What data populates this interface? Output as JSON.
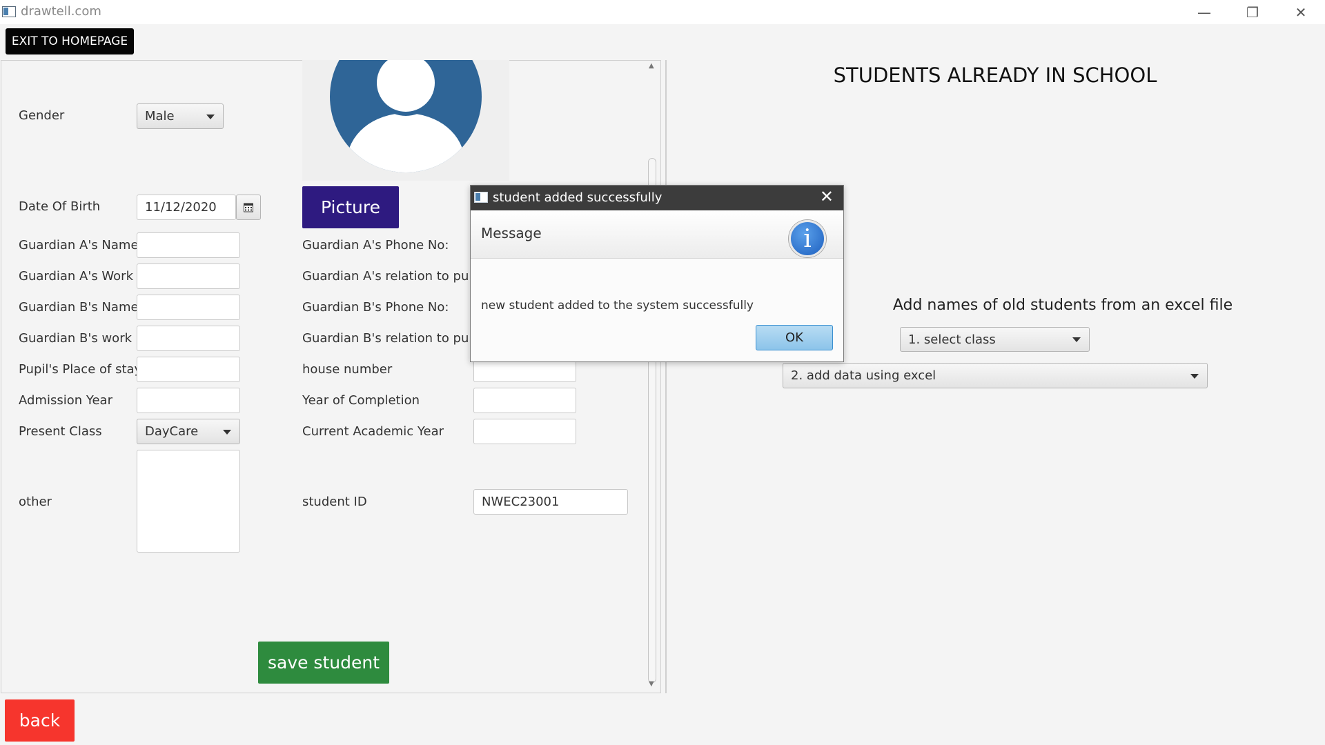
{
  "window": {
    "title": "drawtell.com",
    "controls": {
      "minimize": "—",
      "restore": "❐",
      "close": "✕"
    }
  },
  "toolbar": {
    "exit_label": "EXIT TO HOMEPAGE"
  },
  "form": {
    "gender_label": "Gender",
    "gender_value": "Male",
    "dob_label": "Date Of Birth",
    "dob_value": "11/12/2020",
    "picture_label": "Picture",
    "left_fields": [
      {
        "label": "Guardian A's Name",
        "value": ""
      },
      {
        "label": "Guardian A's Work",
        "value": ""
      },
      {
        "label": "Guardian B's Name",
        "value": ""
      },
      {
        "label": "Guardian B's work",
        "value": ""
      },
      {
        "label": "Pupil's Place of stay",
        "value": ""
      },
      {
        "label": "Admission Year",
        "value": ""
      }
    ],
    "present_class_label": "Present Class",
    "present_class_value": "DayCare",
    "other_label": "other",
    "right_fields": [
      {
        "label": "Guardian A's Phone No:",
        "value": ""
      },
      {
        "label": "Guardian A's relation to pupil",
        "value": ""
      },
      {
        "label": "Guardian B's Phone No:",
        "value": ""
      },
      {
        "label": "Guardian B's relation to pupil",
        "value": ""
      },
      {
        "label": "house number",
        "value": ""
      },
      {
        "label": "Year of Completion",
        "value": ""
      },
      {
        "label": "Current Academic Year",
        "value": ""
      }
    ],
    "student_id_label": "student ID",
    "student_id_value": "NWEC23001",
    "save_label": "save student"
  },
  "right_panel": {
    "title": "STUDENTS ALREADY IN SCHOOL",
    "subtitle": "Add names of old students from an excel file",
    "select_class": "1. select class",
    "add_excel": "2. add data using excel"
  },
  "dialog": {
    "title": "student added successfully",
    "header": "Message",
    "content": "new student added to the system successfully",
    "ok_label": "OK",
    "close": "✕"
  },
  "footer": {
    "back_label": "back"
  },
  "colors": {
    "picture_button": "#2e1a80",
    "save_button": "#2e8b3e",
    "back_button": "#f6352d",
    "avatar": "#2f6597"
  },
  "icons": [
    "app-icon",
    "calendar-icon",
    "info-icon",
    "avatar-icon",
    "close-icon",
    "chevron-down-icon"
  ]
}
